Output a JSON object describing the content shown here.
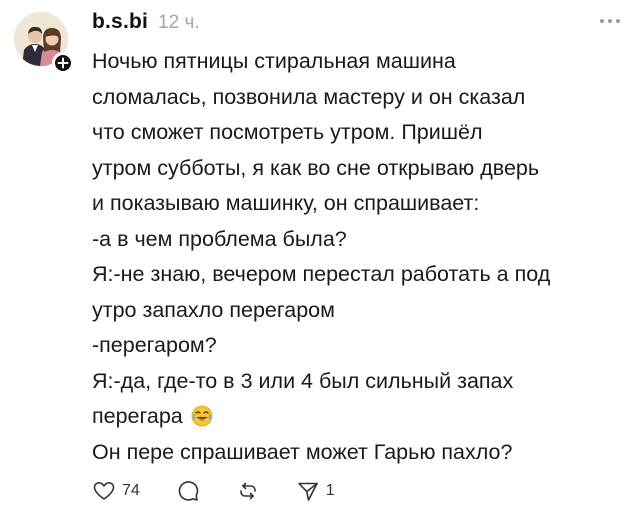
{
  "post": {
    "author": {
      "username": "b.s.bi",
      "time": "12 ч.",
      "avatar_icon": "couple-illustration-avatar",
      "follow_icon": "plus-icon"
    },
    "lines": [
      "Ночью пятницы стиральная машина",
      "сломалась, позвонила мастеру и он сказал",
      "что сможет посмотреть утром. Пришёл",
      "утром субботы, я как во сне открываю дверь",
      "и показываю машинку, он спрашивает:",
      "-а в чем проблема была?",
      "Я:-не знаю, вечером перестал работать а под",
      "утро запахло перегаром",
      "-перегаром?",
      "Я:-да, где-то в 3 или 4 был сильный запах",
      "перегара",
      "Он пере спрашивает может Гарью пахло?"
    ],
    "emoji_after_line_11": "laughing-crying-emoji"
  },
  "actions": {
    "like_icon": "heart-icon",
    "like_count": "74",
    "comment_icon": "comment-bubble-icon",
    "repost_icon": "repost-icon",
    "share_icon": "send-icon",
    "share_count": "1"
  },
  "colors": {
    "text": "#1a1a1a",
    "muted": "#a6a6a6",
    "background": "#ffffff",
    "badge": "#111111"
  }
}
